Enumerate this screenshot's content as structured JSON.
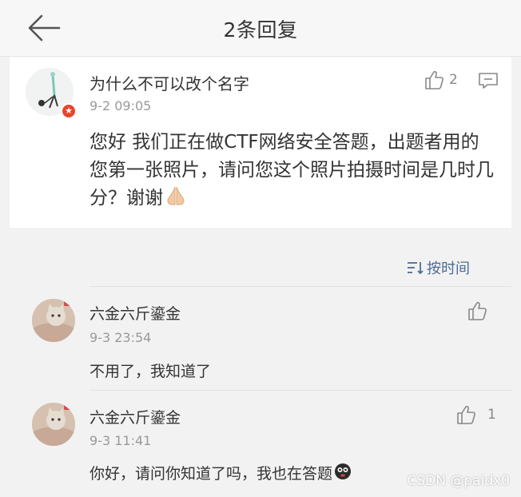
{
  "header": {
    "title": "2条回复",
    "back_icon": "back-arrow-icon"
  },
  "main_comment": {
    "user_name": "为什么不可以改个名字",
    "time": "9-2 09:05",
    "like_count": "2",
    "text": "您好 我们正在做CTF网络安全答题，出题者用的您第一张照片，请问您这个照片拍摄时间是几时几分？谢谢",
    "text_emoji": "folded-hands-emoji",
    "badge_icon": "verified-badge-icon",
    "like_icon": "thumbs-up-icon",
    "comment_icon": "comment-icon"
  },
  "sort": {
    "label": "按时间",
    "icon": "sort-icon",
    "accent_color": "#4b6b96"
  },
  "replies": [
    {
      "user_name": "六金六斤鎏金",
      "time": "9-3 23:54",
      "text": "不用了，我知道了",
      "like_count": ""
    },
    {
      "user_name": "六金六斤鎏金",
      "time": "9-3 11:41",
      "text": "你好，请问你知道了吗，我也在答题",
      "text_emoji": "face-emoji",
      "like_count": "1"
    }
  ],
  "watermark": "CSDN @paidx0"
}
